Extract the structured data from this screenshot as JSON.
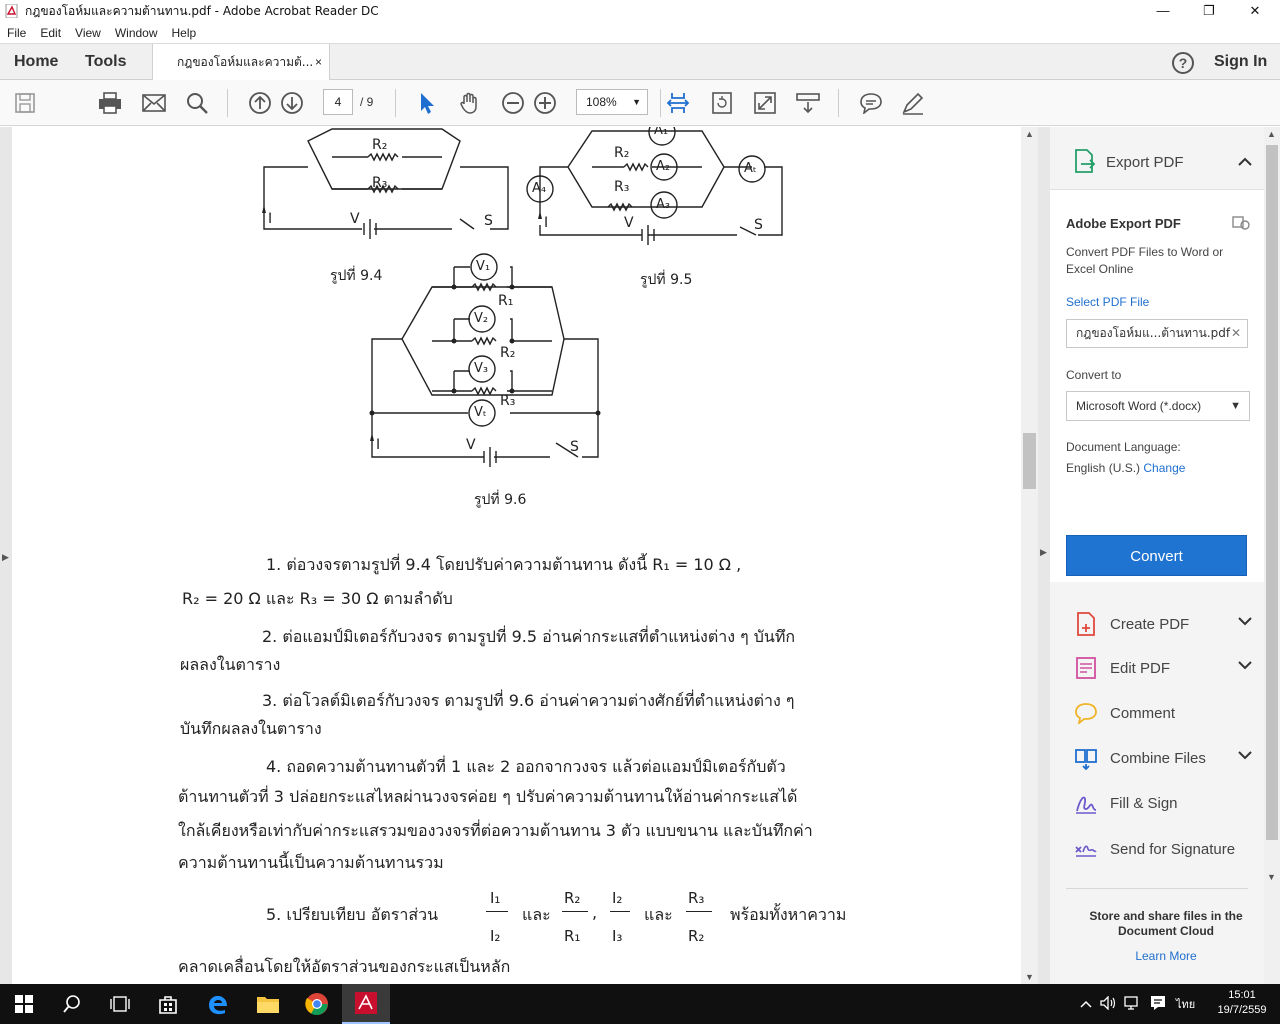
{
  "window": {
    "title": "กฎของโอห์มและความต้านทาน.pdf - Adobe Acrobat Reader DC",
    "minimize": "—",
    "maximize": "❐",
    "close": "✕"
  },
  "menu": [
    "File",
    "Edit",
    "View",
    "Window",
    "Help"
  ],
  "tabs": {
    "home": "Home",
    "tools": "Tools",
    "document": "กฎของโอห์มและความต้...",
    "close": "×",
    "help": "?",
    "sign_in": "Sign In"
  },
  "toolbar": {
    "page_current": "4",
    "page_total": "/  9",
    "zoom": "108%",
    "icons": [
      "save-icon",
      "print-icon",
      "email-icon",
      "search-icon",
      "page-up-icon",
      "page-down-icon",
      "select-arrow-icon",
      "hand-icon",
      "zoom-out-icon",
      "zoom-in-icon",
      "fit-width-icon",
      "rotate-icon",
      "fullscreen-icon",
      "scroll-mode-icon",
      "comment-icon",
      "highlight-icon"
    ]
  },
  "document": {
    "caption_94": "รูปที่ 9.4",
    "caption_95": "รูปที่ 9.5",
    "caption_96": "รูปที่ 9.6",
    "lines": [
      "1.   ต่อวงจรตามรูปที่ 9.4   โดยปรับค่าความต้านทาน  ดังนี้   R₁ = 10 Ω ,",
      "R₂  = 20 Ω  และ R₃  = 30 Ω  ตามลำดับ",
      "2.  ต่อแอมป์มิเตอร์กับวงจร  ตามรูปที่ 9.5  อ่านค่ากระแสที่ตำแหน่งต่าง ๆ บันทึก",
      "ผลลงในตาราง",
      "3.  ต่อโวลต์มิเตอร์กับวงจร   ตามรูปที่ 9.6 อ่านค่าความต่างศักย์ที่ตำแหน่งต่าง ๆ",
      "บันทึกผลลงในตาราง",
      "4.   ถอดความต้านทานตัวที่  1  และ  2  ออกจากวงจร  แล้วต่อแอมป์มิเตอร์กับตัว",
      "ต้านทานตัวที่ 3   ปล่อยกระแสไหลผ่านวงจรค่อย ๆ ปรับค่าความต้านทานให้อ่านค่ากระแสได้",
      "ใกล้เคียงหรือเท่ากับค่ากระแสรวมของวงจรที่ต่อความต้านทาน 3 ตัว แบบขนาน และบันทึกค่า",
      "ความต้านทานนี้เป็นความต้านทานรวม",
      "5.   เปรียบเทียบ  อัตราส่วน",
      "และ",
      "และ",
      "พร้อมทั้งหาความ",
      "คลาดเคลื่อนโดยให้อัตราส่วนของกระแสเป็นหลัก"
    ],
    "fractions": {
      "f1_num": "I₁",
      "f1_den": "I₂",
      "f2_num": "R₂",
      "f2_den": "R₁",
      "f3_num": "I₂",
      "f3_den": "I₃",
      "f4_num": "R₃",
      "f4_den": "R₂"
    },
    "circuit_labels": {
      "R2": "R₂",
      "R3": "R₃",
      "R1": "R₁",
      "I": "I",
      "V": "V",
      "S": "S",
      "A1": "A₁",
      "A2": "A₂",
      "A3": "A₃",
      "A4": "A₄",
      "At": "Aₜ",
      "V1": "V₁",
      "V2": "V₂",
      "V3": "V₃",
      "Vt": "Vₜ"
    }
  },
  "right_panel": {
    "export_header": "Export PDF",
    "export_title": "Adobe Export PDF",
    "export_desc": "Convert PDF Files to Word or Excel Online",
    "select_file": "Select PDF File",
    "file_name": "กฎของโอห์มแ...ต้านทาน.pdf",
    "convert_to": "Convert to",
    "format": "Microsoft Word (*.docx)",
    "doc_language_label": "Document Language:",
    "doc_language": "English (U.S.)",
    "change": "Change",
    "convert_button": "Convert",
    "tools": [
      {
        "label": "Create PDF",
        "chevron": true
      },
      {
        "label": "Edit PDF",
        "chevron": true
      },
      {
        "label": "Comment",
        "chevron": false
      },
      {
        "label": "Combine Files",
        "chevron": true
      },
      {
        "label": "Fill & Sign",
        "chevron": false
      },
      {
        "label": "Send for Signature",
        "chevron": false
      }
    ],
    "store_text": "Store and share files in the Document Cloud",
    "learn_more": "Learn More"
  },
  "taskbar": {
    "lang": "ไทย",
    "time": "15:01",
    "date": "19/7/2559"
  },
  "colors": {
    "accent": "#1f73d1",
    "adobe_red": "#c8102e"
  }
}
